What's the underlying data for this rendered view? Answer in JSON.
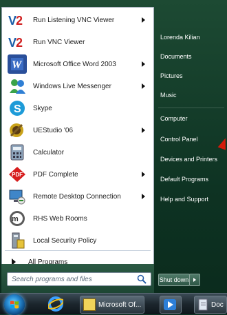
{
  "start_menu": {
    "programs": [
      {
        "label": "Run Listening VNC Viewer",
        "has_submenu": true,
        "icon": "vnc-icon"
      },
      {
        "label": "Run VNC Viewer",
        "has_submenu": false,
        "icon": "vnc-icon"
      },
      {
        "label": "Microsoft Office Word 2003",
        "has_submenu": true,
        "icon": "word-icon"
      },
      {
        "label": "Windows Live Messenger",
        "has_submenu": true,
        "icon": "messenger-icon"
      },
      {
        "label": "Skype",
        "has_submenu": false,
        "icon": "skype-icon"
      },
      {
        "label": "UEStudio '06",
        "has_submenu": true,
        "icon": "uestudio-icon"
      },
      {
        "label": "Calculator",
        "has_submenu": false,
        "icon": "calculator-icon"
      },
      {
        "label": "PDF Complete",
        "has_submenu": true,
        "icon": "pdf-icon"
      },
      {
        "label": "Remote Desktop Connection",
        "has_submenu": true,
        "icon": "remote-desktop-icon"
      },
      {
        "label": "RHS Web Rooms",
        "has_submenu": false,
        "icon": "web-rooms-icon"
      },
      {
        "label": "Local Security Policy",
        "has_submenu": false,
        "icon": "security-policy-icon"
      }
    ],
    "all_programs_label": "All Programs",
    "search_placeholder": "Search programs and files",
    "right_items": [
      {
        "label": "Lorenda Kilian"
      },
      {
        "label": "Documents"
      },
      {
        "label": "Pictures"
      },
      {
        "label": "Music"
      },
      {
        "label": "Computer"
      },
      {
        "label": "Control Panel"
      },
      {
        "label": "Devices and Printers"
      },
      {
        "label": "Default Programs"
      },
      {
        "label": "Help and Support"
      }
    ],
    "shutdown_label": "Shut down"
  },
  "taskbar": {
    "buttons": [
      {
        "label": "Microsoft Of..."
      },
      {
        "label": ""
      },
      {
        "label": "Doc"
      }
    ]
  },
  "colors": {
    "accent_red": "#d41a0a",
    "menu_green": "#1d4634"
  }
}
